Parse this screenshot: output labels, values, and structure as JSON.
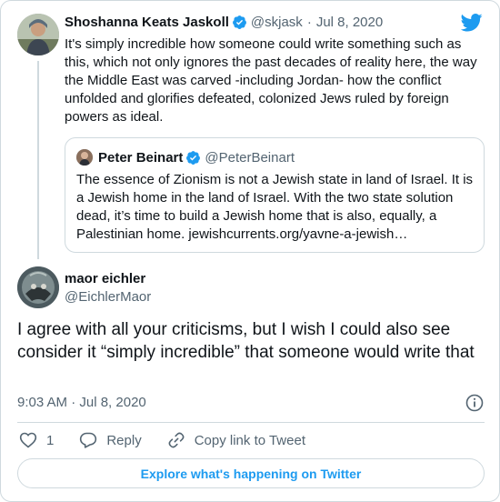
{
  "original": {
    "name": "Shoshanna Keats Jaskoll",
    "handle": "@skjask",
    "separator": "·",
    "date": "Jul 8, 2020",
    "text": "It's simply incredible how someone could write something such as this, which not only ignores the past decades of reality here, the way the Middle East was carved -including Jordan- how the conflict unfolded and glorifies defeated, colonized Jews ruled by foreign powers as ideal."
  },
  "quoted": {
    "name": "Peter Beinart",
    "handle": "@PeterBeinart",
    "text": "The essence of Zionism is not a Jewish state in land of Israel. It is a Jewish home in the land of Israel. With the two state solution dead, it’s time to build a Jewish home that is also, equally, a Palestinian home. jewishcurrents.org/yavne-a-jewish…"
  },
  "reply": {
    "name": "maor eichler",
    "handle": "@EichlerMaor",
    "text": "I agree with all your criticisms, but I wish I could also see consider it “simply incredible” that someone would write that",
    "time": "9:03 AM · Jul 8, 2020"
  },
  "actions": {
    "like_count": "1",
    "reply_label": "Reply",
    "copy_label": "Copy link to Tweet"
  },
  "explore_label": "Explore what's happening on Twitter",
  "colors": {
    "accent": "#1d9bf0",
    "muted": "#536471",
    "border": "#cfd9de"
  },
  "icons": {
    "brand": "twitter-bird-icon",
    "verified": "verified-badge-icon",
    "info": "info-icon",
    "like": "heart-icon",
    "reply": "reply-bubble-icon",
    "copy": "link-icon"
  }
}
